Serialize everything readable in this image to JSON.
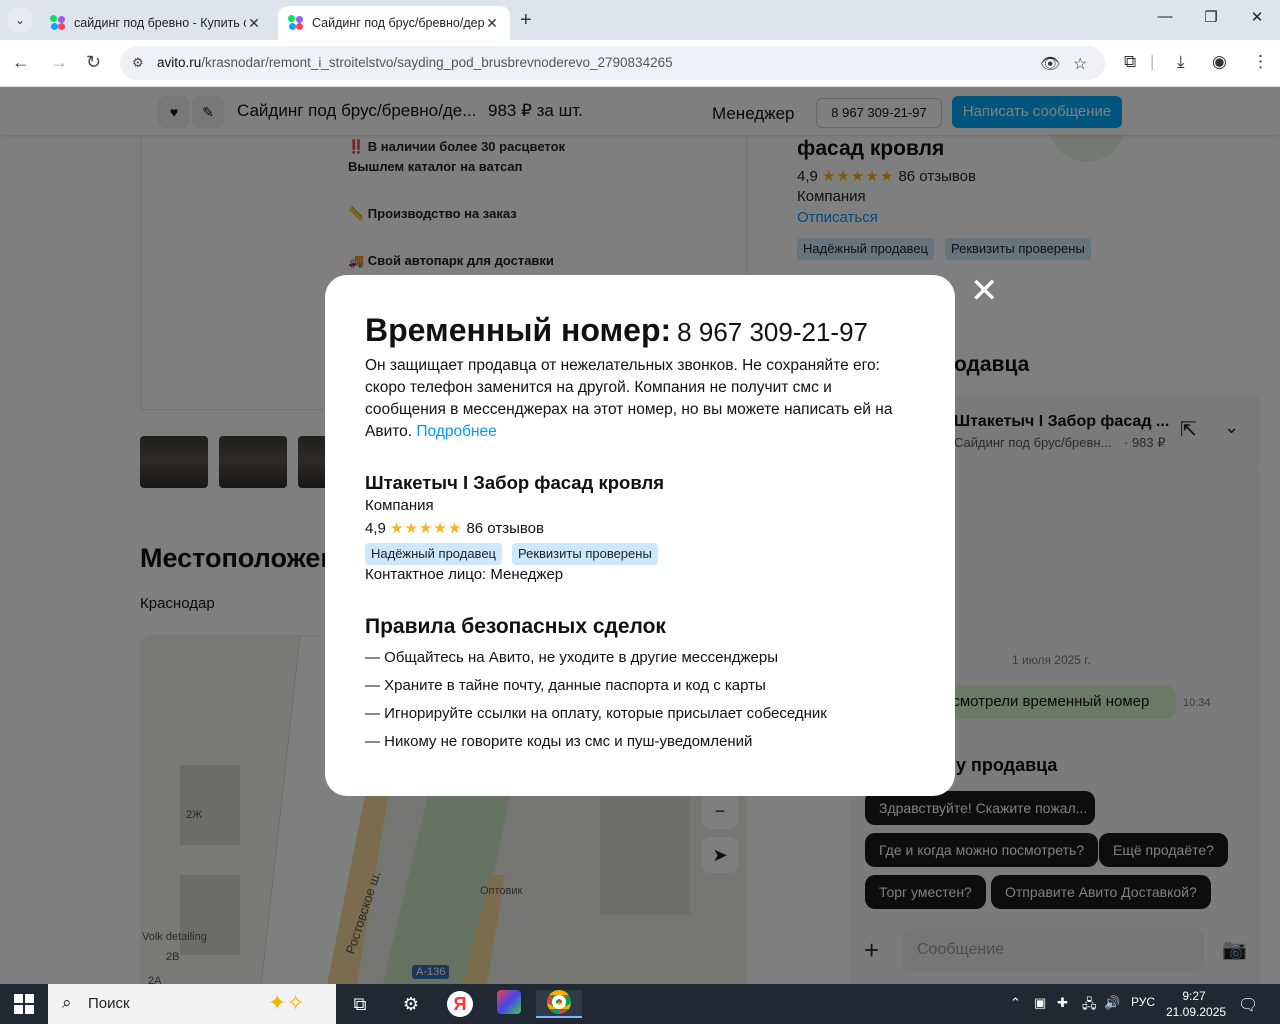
{
  "browser": {
    "tabs": [
      {
        "title": "сайдинг под бревно - Купить с",
        "active": false
      },
      {
        "title": "Сайдинг под брус/бревно/дер",
        "active": true
      }
    ],
    "url_domain": "avito.ru",
    "url_path": "/krasnodar/remont_i_stroitelstvo/sayding_pod_brusbrevnoderevo_2790834265"
  },
  "sticky": {
    "title": "Сайдинг под брус/бревно/де...",
    "price": "983 ₽ за шт.",
    "manager": "Менеджер",
    "phone": "8 967 309-21-97",
    "message_button": "Написать сообщение"
  },
  "description": [
    "‼️ В наличии более 30 расцветок",
    "Вышлем каталог на ватсап",
    "📏 Производство на заказ",
    "🚚 Свой автопарк для доставки"
  ],
  "location": {
    "title": "Местоположение",
    "city": "Краснодар",
    "map_labels": [
      "2Ж",
      "Оптовик",
      "Volk detailing",
      "2В",
      "2А",
      "Ростовское ш.",
      "А-136"
    ]
  },
  "seller": {
    "name": "Штакетыч I Забор фасад кровля",
    "name_visible_fragment": "фасад кровля",
    "rating": "4,9",
    "reviews": "86 отзывов",
    "type": "Компания",
    "unsubscribe": "Отписаться",
    "badges": [
      "Надёжный продавец",
      "Реквизиты проверены"
    ],
    "contact": "Контактное лицо: Менеджер"
  },
  "chat": {
    "section_title": "Спросите у продавца",
    "section_visible": "одавца",
    "name": "Штакетыч I Забор фасад ...",
    "item": "Сайдинг под брус/бревн...",
    "price": "· 983 ₽",
    "date": "1 июля 2025 г.",
    "bubble": "Посмотрели временный номер",
    "bubble_visible": "осмотрели временный номер",
    "time": "10:34",
    "quick_title": "у продавца",
    "quick_replies": [
      "Здравствуйте! Скажите пожал...",
      "Где и когда можно посмотреть?",
      "Ещё продаёте?",
      "Торг уместен?",
      "Отправите Авито Доставкой?"
    ],
    "placeholder": "Сообщение"
  },
  "modal": {
    "title": "Временный номер:",
    "phone": "8 967 309-21-97",
    "description": "Он защищает продавца от нежелательных звонков. Не сохраняйте его: скоро телефон заменится на другой. Компания не получит смс и сообщения в мессенджерах на этот номер, но вы можете написать ей на Авито.",
    "more_link": "Подробнее",
    "rules_title": "Правила безопасных сделок",
    "rules": [
      "— Общайтесь на Авито, не уходите в другие мессенджеры",
      "— Храните в тайне почту, данные паспорта и код с карты",
      "— Игнорируйте ссылки на оплату, которые присылает собеседник",
      "— Никому не говорите коды из смс и пуш-уведомлений"
    ]
  },
  "taskbar": {
    "search_placeholder": "Поиск",
    "language": "РУС",
    "time": "9:27",
    "date": "21.09.2025"
  },
  "colors": {
    "accent": "#00aaff",
    "link": "#0099f7",
    "badge_bg": "#cce9fb",
    "star": "#ffb021",
    "taskbar": "#1f2833"
  }
}
